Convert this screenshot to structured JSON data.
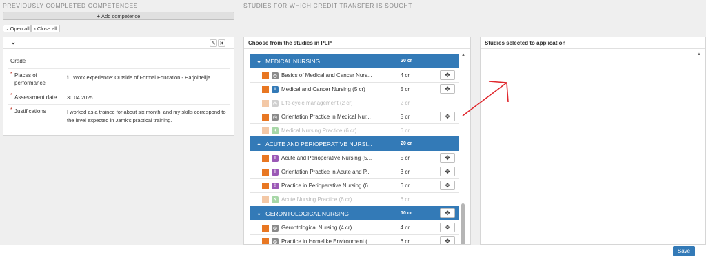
{
  "left": {
    "title": "PREVIOUSLY COMPLETED COMPETENCES",
    "add_label": "Add competence",
    "open_all": "Open all",
    "close_all": "Close all",
    "fields": [
      {
        "label": "Grade",
        "value": "",
        "required": false
      },
      {
        "label": "Places of performance",
        "value": "Work experience: Outside of Formal Education - Harjoittelija",
        "required": true
      },
      {
        "label": "Assessment date",
        "value": "30.04.2025",
        "required": true
      },
      {
        "label": "Justifications",
        "value": "I worked as a trainee for about six month, and my skills correspond to the level expected in Jamk's practical training.",
        "required": true
      }
    ]
  },
  "studies": {
    "title": "STUDIES FOR WHICH CREDIT TRANSFER IS SOUGHT",
    "choose_title": "Choose from the studies in PLP",
    "selected_title": "Studies selected to application",
    "groups": [
      {
        "name": "MEDICAL NURSING",
        "cr": "20 cr",
        "items": [
          {
            "name": "Basics of Medical and Cancer Nurs...",
            "cr": "4 cr",
            "icon": "clock",
            "active": true
          },
          {
            "name": "Medical and Cancer Nursing (5 cr)",
            "cr": "5 cr",
            "icon": "info",
            "active": true
          },
          {
            "name": "Life-cycle management (2 cr)",
            "cr": "2 cr",
            "icon": "clock",
            "active": false
          },
          {
            "name": "Orientation Practice in Medical Nur...",
            "cr": "5 cr",
            "icon": "clock",
            "active": true
          },
          {
            "name": "Medical Nursing Practice (6 cr)",
            "cr": "6 cr",
            "icon": "k",
            "active": false
          }
        ]
      },
      {
        "name": "ACUTE AND PERIOPERATIVE NURSI...",
        "cr": "20 cr",
        "items": [
          {
            "name": "Acute and Perioperative Nursing (5...",
            "cr": "5 cr",
            "icon": "excl",
            "active": true
          },
          {
            "name": "Orientation Practice in Acute and P...",
            "cr": "3 cr",
            "icon": "excl",
            "active": true
          },
          {
            "name": "Practice in Perioperative Nursing (6...",
            "cr": "6 cr",
            "icon": "excl",
            "active": true
          },
          {
            "name": "Acute Nursing Practice (6 cr)",
            "cr": "6 cr",
            "icon": "k",
            "active": false
          }
        ]
      },
      {
        "name": "GERONTOLOGICAL NURSING",
        "cr": "10 cr",
        "items": [
          {
            "name": "Gerontological Nursing (4 cr)",
            "cr": "4 cr",
            "icon": "clock",
            "active": true
          },
          {
            "name": "Practice in Homelike Environment (...",
            "cr": "6 cr",
            "icon": "clock",
            "active": true
          }
        ]
      }
    ]
  },
  "footer": {
    "save_label": "Save"
  },
  "colors": {
    "accent": "#337ab7",
    "orange": "#e87722",
    "arrow": "#e0282e"
  }
}
